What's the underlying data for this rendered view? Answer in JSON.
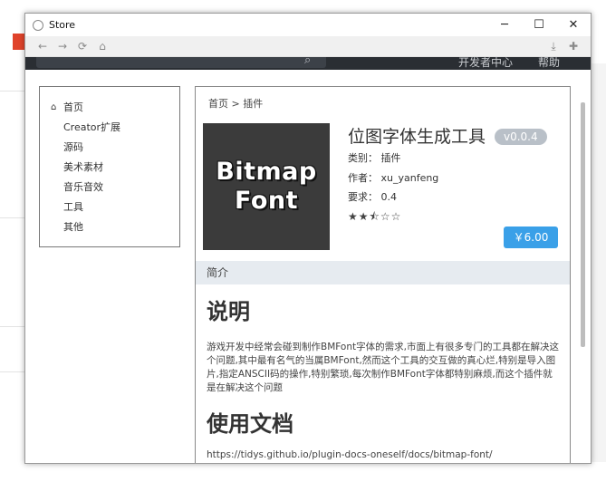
{
  "window": {
    "title": "Store",
    "controls": {
      "minimize": "─",
      "maximize": "☐",
      "close": "✕"
    }
  },
  "toolbar": {
    "back_icon": "←",
    "forward_icon": "→",
    "reload_icon": "⟳",
    "home_icon": "⌂",
    "download_icon": "⤓",
    "extension_icon": "✚"
  },
  "site_header": {
    "links": [
      "开发者中心",
      "帮助"
    ],
    "search_icon": "⌕"
  },
  "sidebar": {
    "home_icon": "⌂",
    "items": [
      "首页",
      "Creator扩展",
      "源码",
      "美术素材",
      "音乐音效",
      "工具",
      "其他"
    ]
  },
  "breadcrumb": "首页 > 插件",
  "product": {
    "cover_line1": "Bitmap",
    "cover_line2": "Font",
    "name": "位图字体生成工具",
    "version": "v0.0.4",
    "category": "类别： 插件",
    "author": "作者： xu_yanfeng",
    "requires": "要求： 0.4",
    "rating": 2.5,
    "stars": "★★⯪☆☆",
    "price": "￥6.00"
  },
  "intro": {
    "tab": "简介",
    "heading_desc": "说明",
    "description": "游戏开发中经常会碰到制作BMFont字体的需求,市面上有很多专门的工具都在解决这个问题,其中最有名气的当属BMFont,然而这个工具的交互做的真心烂,特别是导入图片,指定ANSCII码的操作,特别繁琐,每次制作BMFont字体都特别麻烦,而这个插件就是在解决这个问题",
    "heading_docs": "使用文档",
    "doc_link": "https://tidys.github.io/plugin-docs-oneself/docs/bitmap-font/"
  },
  "colors": {
    "header_bg": "#2a2e33",
    "buy_button": "#3aa0e8",
    "version_badge": "#b9c0c8",
    "intro_bar": "#e6ebf0"
  }
}
